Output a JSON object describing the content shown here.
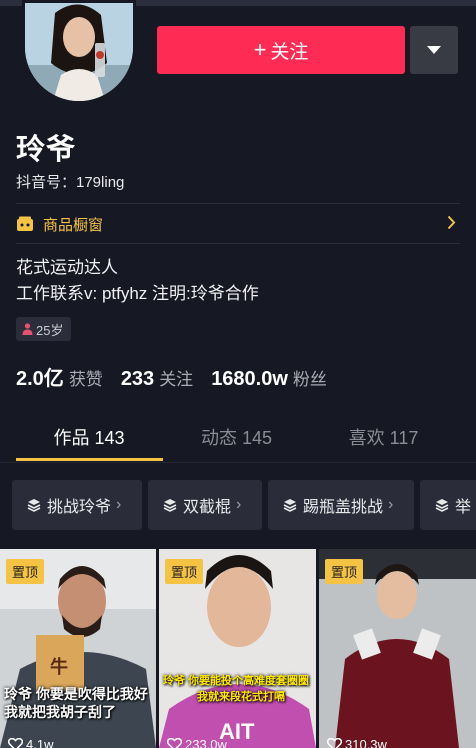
{
  "header": {
    "follow_button": "关注",
    "follow_plus": "+",
    "more_icon": "caret-down-icon"
  },
  "profile": {
    "name": "玲爷",
    "douyin_id": "抖音号：179ling",
    "shop_label": "商品橱窗",
    "bio_line1": "花式运动达人",
    "bio_line2": "工作联系v: ptfyhz 注明:玲爷合作",
    "age": "25岁"
  },
  "stats": {
    "likes_num": "2.0亿",
    "likes_label": "获赞",
    "following_num": "233",
    "following_label": "关注",
    "fans_num": "1680.0w",
    "fans_label": "粉丝"
  },
  "tabs": [
    {
      "label": "作品 143",
      "active": true
    },
    {
      "label": "动态 145",
      "active": false
    },
    {
      "label": "喜欢 117",
      "active": false
    }
  ],
  "collections": [
    {
      "label": "挑战玲爷"
    },
    {
      "label": "双截棍"
    },
    {
      "label": "踢瓶盖挑战"
    },
    {
      "label": "举"
    }
  ],
  "videos": [
    {
      "pin": "置顶",
      "caption_line1": "玲爷 你要是吹得比我好",
      "caption_line2": "我就把我胡子刮了",
      "sign": "牛",
      "likes": "4.1w"
    },
    {
      "pin": "置顶",
      "caption_line1": "玲爷 你要能投个高难度套圈圈",
      "caption_line2": "我就来段花式打嗝",
      "likes": "233.0w"
    },
    {
      "pin": "置顶",
      "likes": "310.3w"
    }
  ],
  "colors": {
    "background": "#161823",
    "follow_red": "#fe2c55",
    "accent_yellow": "#f5c344"
  }
}
